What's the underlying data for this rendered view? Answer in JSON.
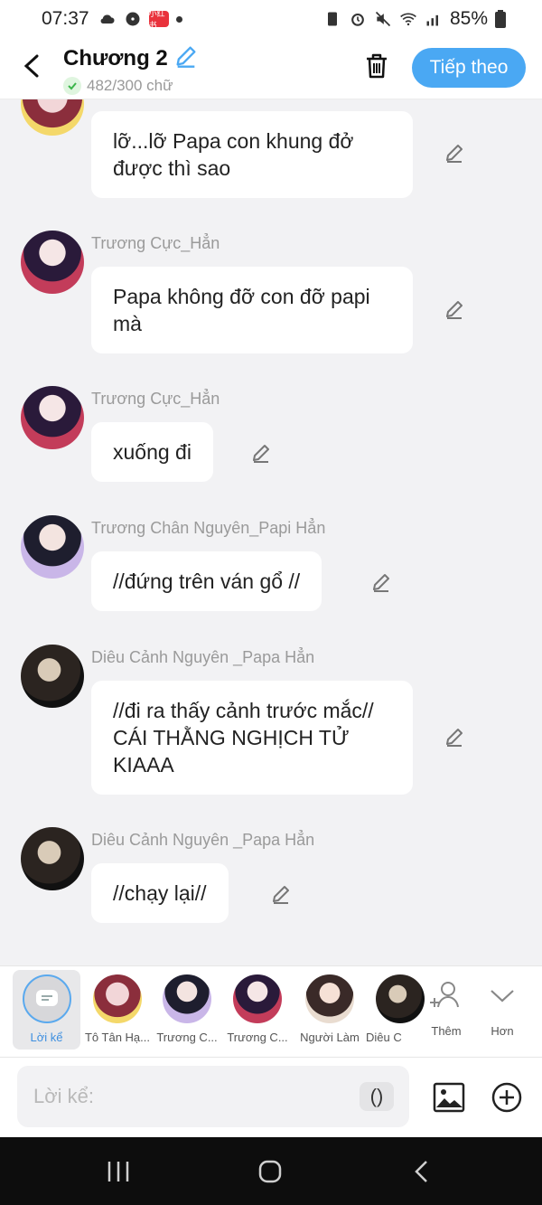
{
  "status": {
    "time": "07:37",
    "app_badge": "小红书",
    "battery": "85%"
  },
  "header": {
    "title": "Chương 2",
    "word_count": "482/300 chữ",
    "next_label": "Tiếp theo"
  },
  "messages": [
    {
      "sender": "",
      "text": "lỡ...lỡ Papa con khung đở được thì sao"
    },
    {
      "sender": "Trương Cực_Hẳn",
      "text": "Papa không đỡ con đỡ papi mà"
    },
    {
      "sender": "Trương Cực_Hẳn",
      "text": "xuống đi"
    },
    {
      "sender": "Trương Chân Nguyên_Papi Hẳn",
      "text": "//đứng trên ván gổ //"
    },
    {
      "sender": "Diêu Cảnh Nguyên _Papa Hẳn",
      "text": "//đi ra thấy cảnh trước mắc// CÁI THẰNG NGHỊCH TỬ KIAAA"
    },
    {
      "sender": "Diêu Cảnh Nguyên _Papa Hẳn",
      "text": "//chạy lại//"
    }
  ],
  "characters": {
    "narrator_label": "Lời kể",
    "items": [
      {
        "label": "Tô Tân Hạ..."
      },
      {
        "label": "Trương C..."
      },
      {
        "label": "Trương C..."
      },
      {
        "label": "Người Làm"
      },
      {
        "label": "Diêu C"
      }
    ],
    "add_label": "Thêm",
    "more_label": "Hơn"
  },
  "input": {
    "placeholder": "Lời kể:",
    "paren_label": "()"
  },
  "colors": {
    "accent": "#4aa8f3",
    "bubble": "#ffffff",
    "background": "#f2f2f4"
  }
}
